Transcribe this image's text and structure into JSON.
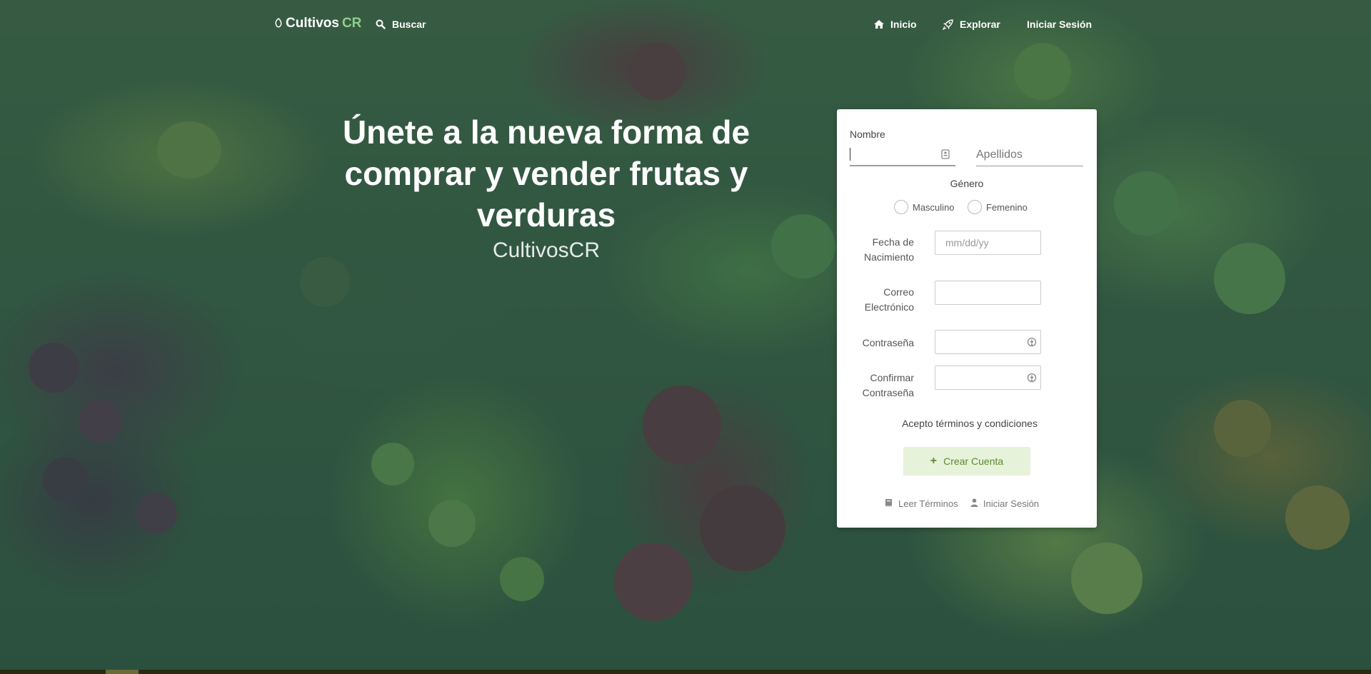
{
  "navbar": {
    "brand_main": "Cultivos",
    "brand_accent": "CR",
    "search_label": "Buscar",
    "links": [
      {
        "label": "Inicio",
        "icon": "home-icon"
      },
      {
        "label": "Explorar",
        "icon": "rocket-icon"
      },
      {
        "label": "Iniciar Sesión"
      }
    ]
  },
  "hero": {
    "title": "Únete a la nueva forma de comprar y vender frutas y verduras",
    "subtitle": "CultivosCR"
  },
  "form": {
    "nombre_label": "Nombre",
    "nombre_value": "",
    "apellidos_placeholder": "Apellidos",
    "genero_label": "Género",
    "genero_options": [
      "Masculino",
      "Femenino"
    ],
    "birth_label": "Fecha de Nacimiento",
    "birth_placeholder": "mm/dd/yy",
    "email_label": "Correo Electrónico",
    "password_label": "Contraseña",
    "confirm_label": "Confirmar Contraseña",
    "terms_text": "Acepto términos y condiciones",
    "create_button": "Crear Cuenta",
    "read_terms": "Leer Términos",
    "login_link": "Iniciar Sesión"
  },
  "colors": {
    "overlay": "#164846",
    "brand_accent": "#8fcf8a",
    "button_bg": "#e6f2da",
    "button_text": "#5b8a2c"
  }
}
